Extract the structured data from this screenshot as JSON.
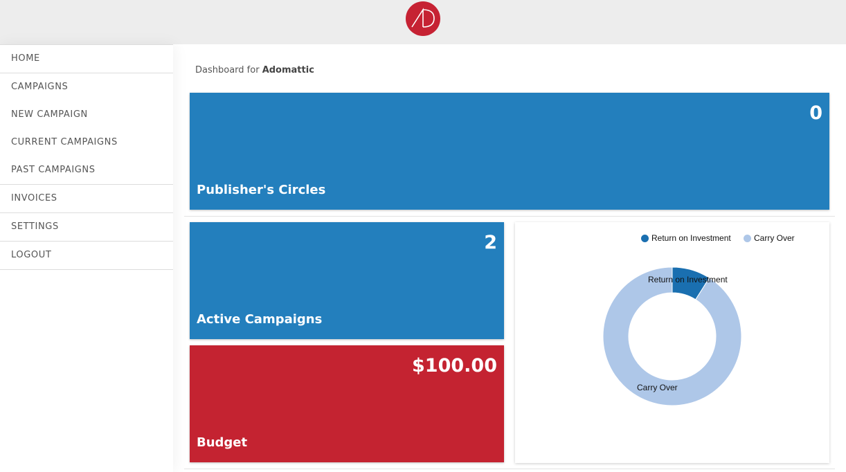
{
  "header": {
    "logo_text": "AD",
    "brand_color": "#c62233"
  },
  "sidebar": {
    "items": [
      {
        "label": "HOME"
      },
      {
        "label": "CAMPAIGNS"
      },
      {
        "label": "NEW CAMPAIGN"
      },
      {
        "label": "CURRENT CAMPAIGNS"
      },
      {
        "label": "PAST CAMPAIGNS"
      },
      {
        "label": "INVOICES"
      },
      {
        "label": "SETTINGS"
      },
      {
        "label": "LOGOUT"
      }
    ]
  },
  "main": {
    "breadcrumb_prefix": "Dashboard for",
    "breadcrumb_name": "Adomattic",
    "cards": {
      "publishers": {
        "value": "0",
        "label": "Publisher's Circles",
        "color": "#237fbd"
      },
      "active": {
        "value": "2",
        "label": "Active Campaigns",
        "color": "#237fbd"
      },
      "budget": {
        "value": "$100.00",
        "label": "Budget",
        "color": "#c42331"
      }
    }
  },
  "chart_data": {
    "type": "pie",
    "variant": "donut",
    "legend_position": "top",
    "categories": [
      "Return on Investment",
      "Carry Over"
    ],
    "values": [
      9,
      91
    ],
    "colors": [
      "#1a6fb0",
      "#aec7e8"
    ]
  }
}
